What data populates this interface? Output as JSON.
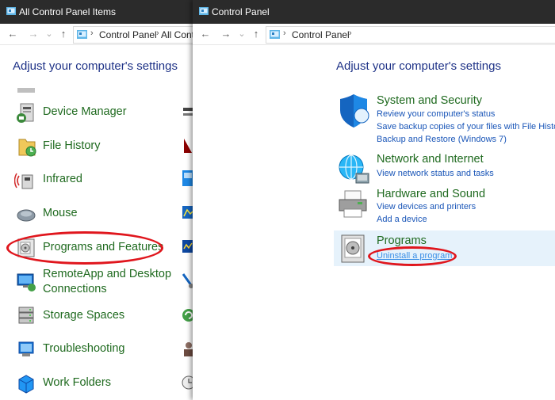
{
  "left_window": {
    "title": "All Control Panel Items",
    "breadcrumb": [
      "Control Panel",
      "All Contr"
    ],
    "heading": "Adjust your computer's settings",
    "items": [
      {
        "label": "Device Manager",
        "icon": "device-manager-icon"
      },
      {
        "label": "File History",
        "icon": "file-history-icon"
      },
      {
        "label": "Infrared",
        "icon": "infrared-icon"
      },
      {
        "label": "Mouse",
        "icon": "mouse-icon"
      },
      {
        "label": "Programs and Features",
        "icon": "programs-features-icon"
      },
      {
        "label_line1": "RemoteApp and Desktop",
        "label_line2": "Connections",
        "icon": "remoteapp-icon"
      },
      {
        "label": "Storage Spaces",
        "icon": "storage-spaces-icon"
      },
      {
        "label": "Troubleshooting",
        "icon": "troubleshooting-icon"
      },
      {
        "label": "Work Folders",
        "icon": "work-folders-icon"
      }
    ]
  },
  "right_window": {
    "title": "Control Panel",
    "breadcrumb": [
      "Control Panel"
    ],
    "heading": "Adjust your computer's settings",
    "categories": [
      {
        "title": "System and Security",
        "icon": "shield-icon",
        "links": [
          "Review your computer's status",
          "Save backup copies of your files with File History",
          "Backup and Restore (Windows 7)"
        ]
      },
      {
        "title": "Network and Internet",
        "icon": "globe-network-icon",
        "links": [
          "View network status and tasks"
        ]
      },
      {
        "title": "Hardware and Sound",
        "icon": "printer-icon",
        "links": [
          "View devices and printers",
          "Add a device"
        ]
      },
      {
        "title": "Programs",
        "icon": "programs-icon",
        "links": [
          "Uninstall a program"
        ]
      }
    ]
  },
  "nav_glyphs": {
    "back": "←",
    "forward": "→",
    "dropdown": "⌄",
    "up": "↑",
    "sep": "›"
  },
  "colors": {
    "title_bar": "#2b2b2b",
    "heading": "#1e3287",
    "item_text": "#1f6a1f",
    "link": "#1a56b8",
    "highlight_oval": "#e0161d",
    "selected_bg": "#e6f2fb"
  }
}
